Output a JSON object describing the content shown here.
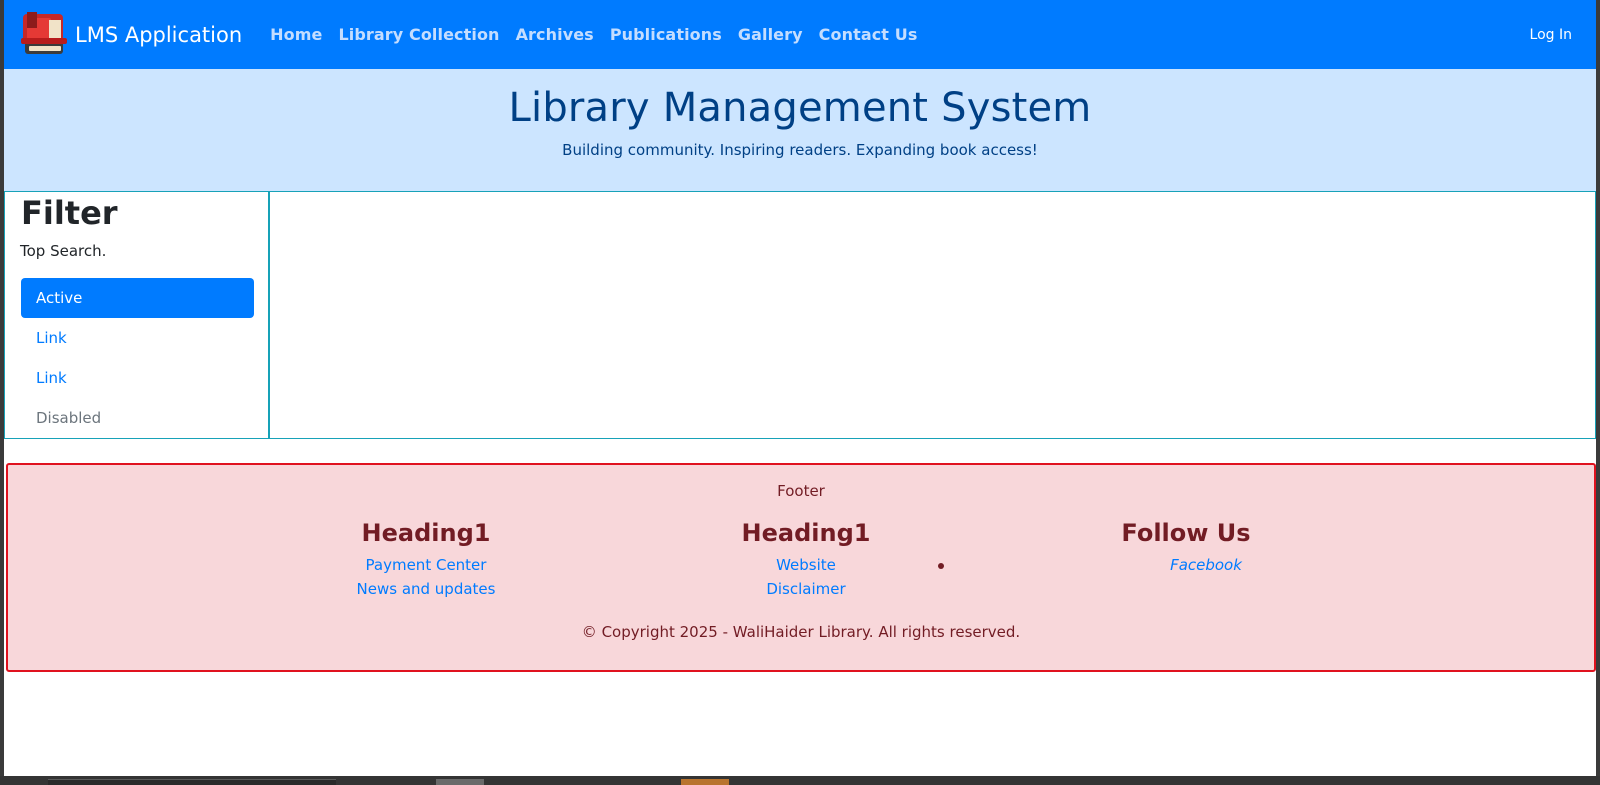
{
  "navbar": {
    "brand": "LMS Application",
    "brand_icon": "book-stack-icon",
    "links": [
      "Home",
      "Library Collection",
      "Archives",
      "Publications",
      "Gallery",
      "Contact Us"
    ],
    "login": "Log In",
    "bg_color": "#007bff"
  },
  "hero": {
    "title": "Library Management System",
    "subtitle": "Building community. Inspiring readers. Expanding book access!"
  },
  "sidebar": {
    "title": "Filter",
    "subtitle": "Top Search.",
    "items": [
      {
        "label": "Active",
        "state": "active"
      },
      {
        "label": "Link",
        "state": "link"
      },
      {
        "label": "Link",
        "state": "link"
      },
      {
        "label": "Disabled",
        "state": "disabled"
      }
    ]
  },
  "footer": {
    "caption": "Footer",
    "columns": [
      {
        "heading": "Heading1",
        "links": [
          "Payment Center",
          "News and updates"
        ]
      },
      {
        "heading": "Heading1",
        "links": [
          "Website",
          "Disclaimer"
        ]
      },
      {
        "heading": "Follow Us",
        "links": [
          "Facebook"
        ]
      }
    ],
    "copyright": "© Copyright 2025 - WaliHaider Library. All rights reserved."
  },
  "colors": {
    "primary": "#007bff",
    "hero_bg": "#cce5ff",
    "footer_bg": "#f8d7da",
    "footer_border": "#e0121f",
    "content_border": "#17a2b8"
  }
}
